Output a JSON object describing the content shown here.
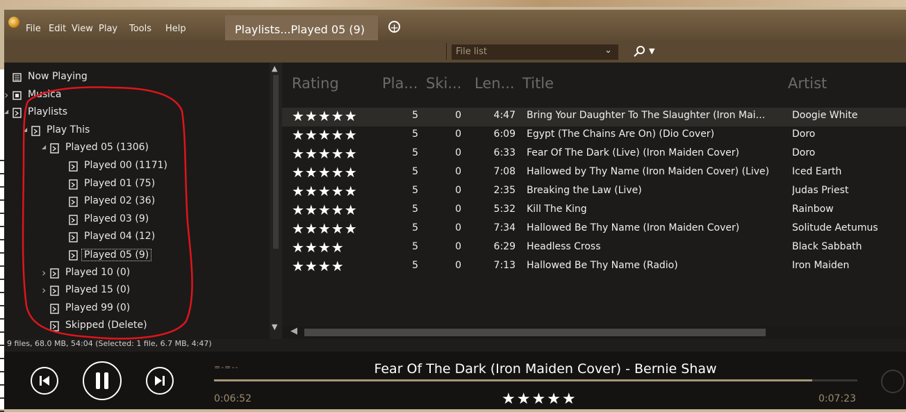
{
  "app": {
    "menu": [
      "File",
      "Edit",
      "View",
      "Play",
      "Tools",
      "Help"
    ],
    "active_tab": "Playlists...Played 05 (9)",
    "add_tab_icon": "plus-circle-icon"
  },
  "toolbar": {
    "view_select": "File list",
    "search_icon": "search-icon"
  },
  "tree": {
    "items": [
      {
        "label": "Now Playing",
        "icon": "now-playing-icon",
        "depth": 0,
        "expander": ""
      },
      {
        "label": "Musica",
        "icon": "library-icon",
        "depth": 0,
        "expander": ">"
      },
      {
        "label": "Playlists",
        "icon": "playlist-icon",
        "depth": 0,
        "expander": "v"
      },
      {
        "label": "Play This",
        "icon": "playlist-icon",
        "depth": 1,
        "expander": "v"
      },
      {
        "label": "Played 05 (1306)",
        "icon": "playlist-icon",
        "depth": 2,
        "expander": "v"
      },
      {
        "label": "Played 00 (1171)",
        "icon": "playlist-icon",
        "depth": 3,
        "expander": ""
      },
      {
        "label": "Played 01 (75)",
        "icon": "playlist-icon",
        "depth": 3,
        "expander": ""
      },
      {
        "label": "Played 02 (36)",
        "icon": "playlist-icon",
        "depth": 3,
        "expander": ""
      },
      {
        "label": "Played 03 (9)",
        "icon": "playlist-icon",
        "depth": 3,
        "expander": ""
      },
      {
        "label": "Played 04 (12)",
        "icon": "playlist-icon",
        "depth": 3,
        "expander": ""
      },
      {
        "label": "Played 05 (9)",
        "icon": "playlist-icon",
        "depth": 3,
        "expander": "",
        "selected": true
      },
      {
        "label": "Played 10 (0)",
        "icon": "playlist-icon",
        "depth": 2,
        "expander": ">"
      },
      {
        "label": "Played 15 (0)",
        "icon": "playlist-icon",
        "depth": 2,
        "expander": ">"
      },
      {
        "label": "Played 99 (0)",
        "icon": "playlist-icon",
        "depth": 2,
        "expander": ""
      },
      {
        "label": "Skipped (Delete)",
        "icon": "playlist-icon",
        "depth": 2,
        "expander": ""
      }
    ]
  },
  "tracklist": {
    "columns": [
      "Rating",
      "Pla...",
      "Ski...",
      "Len...",
      "Title",
      "Artist"
    ],
    "rows": [
      {
        "rating": 5,
        "played": "5",
        "skipped": "0",
        "length": "4:47",
        "title": "Bring Your Daughter To The Slaughter (Iron Mai…",
        "artist": "Doogie White",
        "selected": true
      },
      {
        "rating": 5,
        "played": "5",
        "skipped": "0",
        "length": "6:09",
        "title": "Egypt (The Chains Are On) (Dio Cover)",
        "artist": "Doro"
      },
      {
        "rating": 5,
        "played": "5",
        "skipped": "0",
        "length": "6:33",
        "title": "Fear Of The Dark (Live) (Iron Maiden Cover)",
        "artist": "Doro"
      },
      {
        "rating": 5,
        "played": "5",
        "skipped": "0",
        "length": "7:08",
        "title": "Hallowed by Thy Name (Iron Maiden Cover) (Live)",
        "artist": "Iced Earth"
      },
      {
        "rating": 5,
        "played": "5",
        "skipped": "0",
        "length": "2:35",
        "title": "Breaking the Law (Live)",
        "artist": "Judas Priest"
      },
      {
        "rating": 5,
        "played": "5",
        "skipped": "0",
        "length": "5:32",
        "title": "Kill The King",
        "artist": "Rainbow"
      },
      {
        "rating": 5,
        "played": "5",
        "skipped": "0",
        "length": "7:34",
        "title": "Hallowed Be Thy Name (Iron Maiden Cover)",
        "artist": "Solitude Aetumus"
      },
      {
        "rating": 4,
        "played": "5",
        "skipped": "0",
        "length": "6:29",
        "title": "Headless Cross",
        "artist": "Black Sabbath"
      },
      {
        "rating": 4,
        "played": "5",
        "skipped": "0",
        "length": "7:13",
        "title": "Hallowed Be Thy Name (Radio)",
        "artist": "Iron Maiden"
      }
    ]
  },
  "status": "9 files, 68.0 MB, 54:04 (Selected: 1 file, 6.7 MB, 4:47)",
  "player": {
    "now_playing": "Fear Of The Dark (Iron Maiden Cover) - Bernie Shaw",
    "elapsed": "0:06:52",
    "total": "0:07:23",
    "rating": 5,
    "progress": 0.93,
    "eq_indicator": "=-=--",
    "buttons": [
      "previous-icon",
      "pause-icon",
      "next-icon"
    ]
  },
  "colors": {
    "accent_bar": "#a89577",
    "annotation": "#e0141b"
  }
}
